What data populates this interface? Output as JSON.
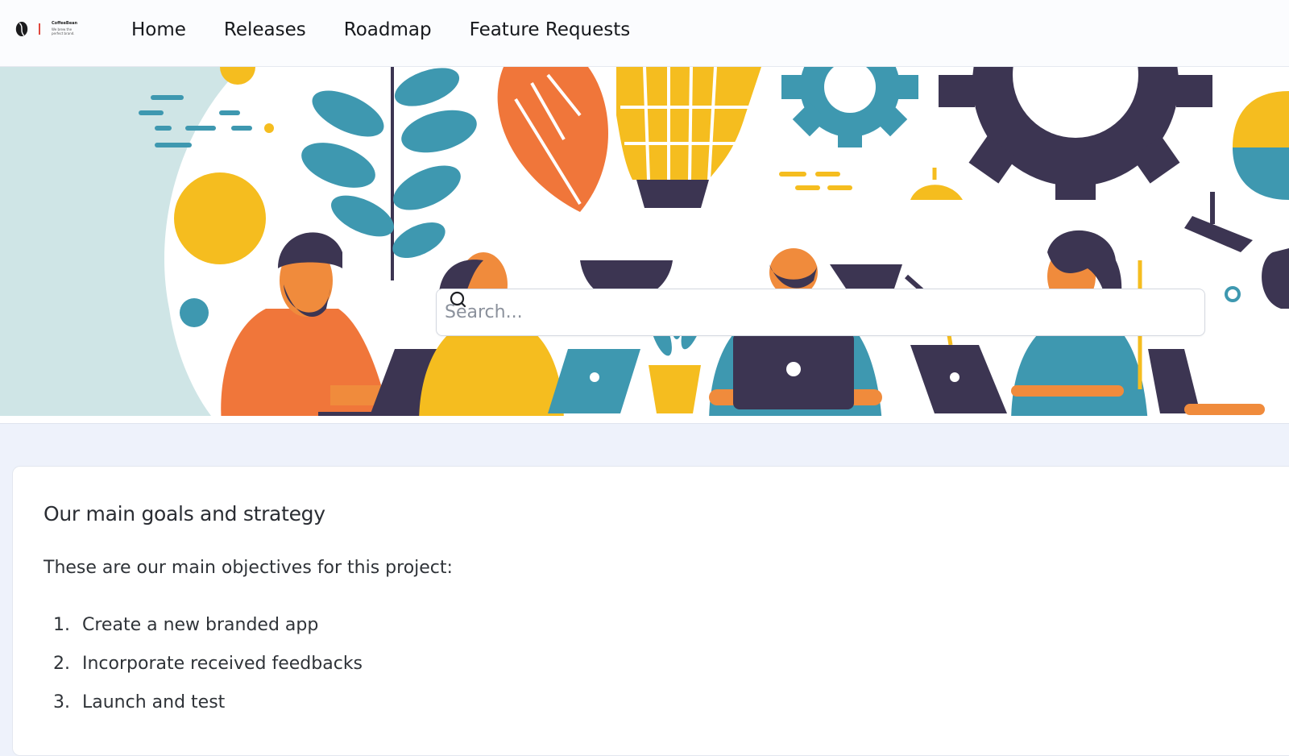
{
  "brand": {
    "name": "CoffeeBean",
    "tagline": "We brew the perfect brand."
  },
  "nav": {
    "items": [
      {
        "label": "Home"
      },
      {
        "label": "Releases"
      },
      {
        "label": "Roadmap"
      },
      {
        "label": "Feature Requests"
      }
    ]
  },
  "search": {
    "placeholder": "Search...",
    "value": ""
  },
  "main": {
    "title": "Our main goals and strategy",
    "intro": "These are our main objectives for this project:",
    "goals": [
      {
        "number": "1.",
        "text": "Create a new branded app"
      },
      {
        "number": "2.",
        "text": "Incorporate received feedbacks"
      },
      {
        "number": "3.",
        "text": "Launch and test"
      }
    ]
  },
  "colors": {
    "orange": "#f0763a",
    "yellow": "#f5bd1f",
    "teal": "#3e98b0",
    "navy": "#3c3552",
    "mint": "#cfe5e6",
    "page_bg": "#eef2fb"
  }
}
